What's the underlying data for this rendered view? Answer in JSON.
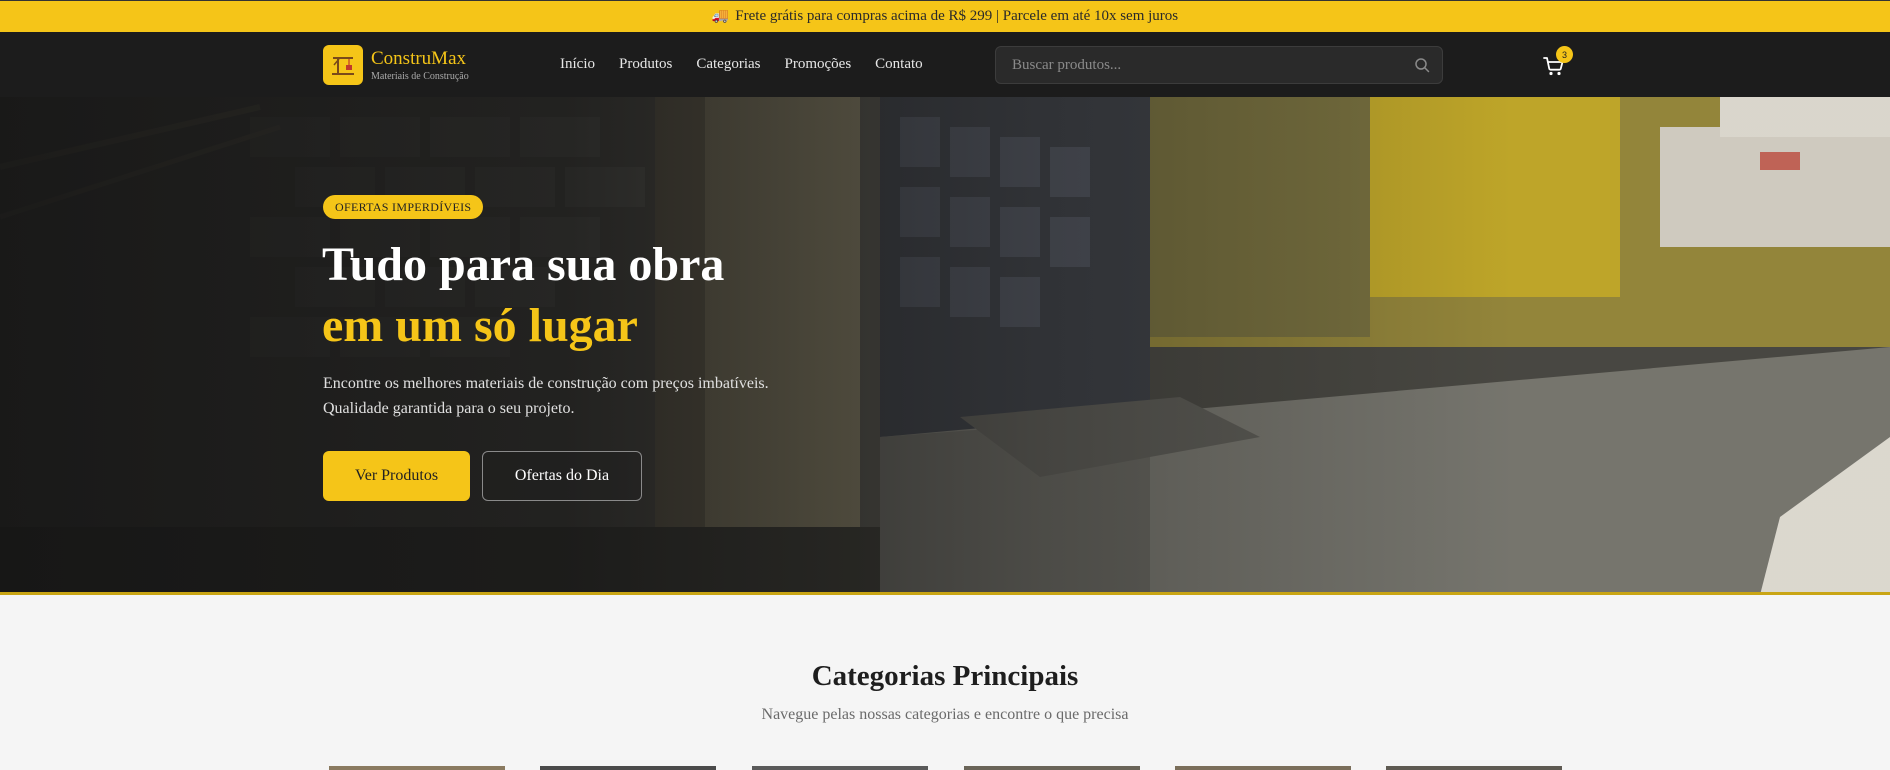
{
  "promo": {
    "text": "Frete grátis para compras acima de R$ 299 | Parcele em até 10x sem juros",
    "icon": "truck-icon"
  },
  "header": {
    "brand": "ConstruMax",
    "tagline": "Materiais de Construção",
    "nav": [
      {
        "label": "Início"
      },
      {
        "label": "Produtos"
      },
      {
        "label": "Categorias"
      },
      {
        "label": "Promoções"
      },
      {
        "label": "Contato"
      }
    ],
    "search": {
      "placeholder": "Buscar produtos..."
    },
    "cart_count": "3"
  },
  "hero": {
    "badge": "OFERTAS IMPERDÍVEIS",
    "title_line1": "Tudo para sua obra",
    "title_line2": "em um só lugar",
    "description": "Encontre os melhores materiais de construção com preços imbatíveis. Qualidade garantida para o seu projeto.",
    "primary_button": "Ver Produtos",
    "secondary_button": "Ofertas do Dia"
  },
  "categories": {
    "title": "Categorias Principais",
    "subtitle": "Navegue pelas nossas categorias e encontre o que precisa"
  },
  "colors": {
    "accent": "#f5c518",
    "header_bg": "#1c1c1c",
    "page_bg": "#f5f5f5"
  }
}
